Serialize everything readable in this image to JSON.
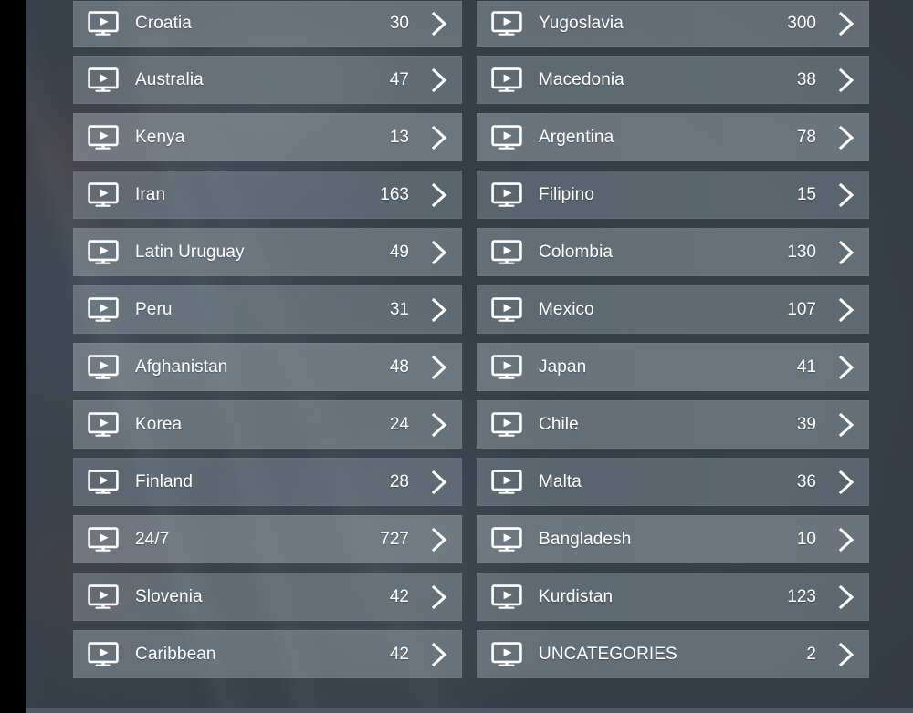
{
  "screen": {
    "app_kind": "iptv-category-list",
    "colors": {
      "background": "#374049",
      "row_fill": "#93a3a9",
      "text": "#ffffff",
      "left_bar": "#000000",
      "bottom_strip": "#4f5a66"
    }
  },
  "icons": {
    "channel": "tv-play-icon",
    "open": "chevron-right-icon"
  },
  "columns": {
    "left": {
      "rows": [
        {
          "label": "Croatia",
          "count": "30"
        },
        {
          "label": "Australia",
          "count": "47"
        },
        {
          "label": "Kenya",
          "count": "13"
        },
        {
          "label": "Iran",
          "count": "163"
        },
        {
          "label": "Latin Uruguay",
          "count": "49"
        },
        {
          "label": "Peru",
          "count": "31"
        },
        {
          "label": "Afghanistan",
          "count": "48"
        },
        {
          "label": "Korea",
          "count": "24"
        },
        {
          "label": "Finland",
          "count": "28"
        },
        {
          "label": "24/7",
          "count": "727"
        },
        {
          "label": "Slovenia",
          "count": "42"
        },
        {
          "label": "Caribbean",
          "count": "42"
        }
      ]
    },
    "right": {
      "rows": [
        {
          "label": "Yugoslavia",
          "count": "300"
        },
        {
          "label": "Macedonia",
          "count": "38"
        },
        {
          "label": "Argentina",
          "count": "78"
        },
        {
          "label": "Filipino",
          "count": "15"
        },
        {
          "label": "Colombia",
          "count": "130"
        },
        {
          "label": "Mexico",
          "count": "107"
        },
        {
          "label": "Japan",
          "count": "41"
        },
        {
          "label": "Chile",
          "count": "39"
        },
        {
          "label": "Malta",
          "count": "36"
        },
        {
          "label": "Bangladesh",
          "count": "10"
        },
        {
          "label": "Kurdistan",
          "count": "123"
        },
        {
          "label": "UNCATEGORIES",
          "count": "2"
        }
      ]
    }
  }
}
